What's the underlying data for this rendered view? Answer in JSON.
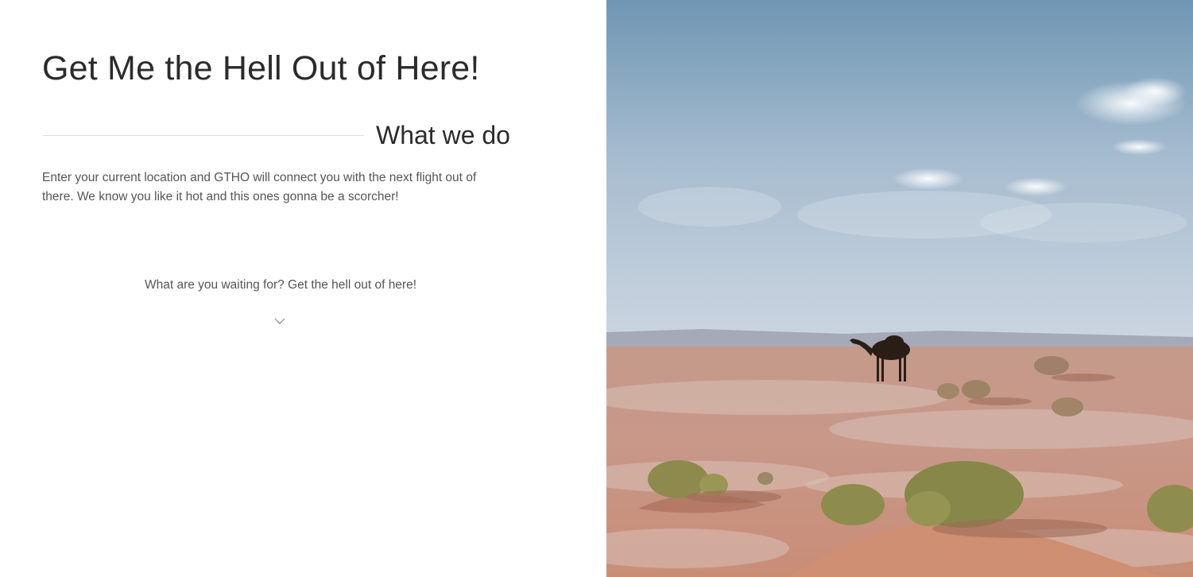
{
  "hero": {
    "title": "Get Me the Hell Out of Here!"
  },
  "about": {
    "heading": "What we do",
    "description": "Enter your current location and GTHO will connect you with the next flight out of there. We know you like it hot and this ones gonna be a scorcher!"
  },
  "cta": {
    "text": "What are you waiting for? Get the hell out of here!",
    "icon": "chevron-down-icon"
  },
  "photo": {
    "subject": "camel-in-desert",
    "colors": {
      "sky_top": "#6f96b4",
      "sky_bottom": "#c9d3df",
      "sand": "#c99584",
      "sand_dark": "#b57c69",
      "shrub": "#8c8a4c",
      "camel": "#2a1d16"
    }
  }
}
